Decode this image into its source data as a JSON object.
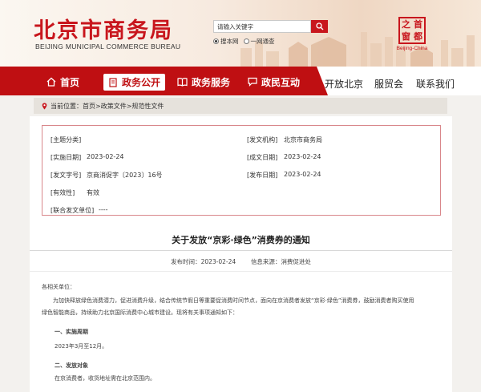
{
  "header": {
    "logo_cn": "北京市商务局",
    "logo_en": "BEIJING MUNICIPAL COMMERCE BUREAU",
    "search_placeholder": "请输入关键字",
    "radio_site": "搜本网",
    "radio_all": "一网通查",
    "capital_chars": [
      "之",
      "首",
      "窗",
      "都"
    ],
    "capital_en": "Beijing-China"
  },
  "nav": {
    "home": "首页",
    "policy": "政务公开",
    "service": "政务服务",
    "interact": "政民互动",
    "open_beijing": "开放北京",
    "trade_fair": "服贸会",
    "contact": "联系我们"
  },
  "breadcrumb": {
    "prefix": "当前位置：",
    "path": "首页>政策文件>规范性文件"
  },
  "meta": {
    "category_label": "[主题分类]",
    "category_value": "",
    "issuer_label": "[发文机构]",
    "issuer_value": "北京市商务局",
    "effective_label": "[实施日期]",
    "effective_value": "2023-02-24",
    "written_label": "[成文日期]",
    "written_value": "2023-02-24",
    "docno_label": "[发文字号]",
    "docno_value": "京商消促字〔2023〕16号",
    "publish_label": "[发布日期]",
    "publish_value": "2023-02-24",
    "validity_label": "[有效性]",
    "validity_value": "有效",
    "joint_label": "[联合发文单位]",
    "joint_value": "----"
  },
  "article": {
    "title": "关于发放“京彩·绿色”消费券的通知",
    "time_label": "发布时间：",
    "time_value": "2023-02-24",
    "source_label": "信息来源：",
    "source_value": "消费促进处",
    "salutation": "各相关单位：",
    "intro_1": "为加快释放绿色消费潜力，促进消费升级，结合传统节假日等重要促消费时间节点，面向在京消费者发放“京彩·绿色”消费券，鼓励消费者购买使用",
    "intro_2": "绿色智能商品，持续助力北京国际消费中心城市建设。现将有关事项通知如下：",
    "section1_title": "一、实施周期",
    "section1_body": "2023年3月至12月。",
    "section2_title": "二、发放对象",
    "section2_body": "在京消费者，收货地址需在北京范围内。"
  },
  "colors": {
    "brand_red": "#c8161d",
    "nav_red": "#bf0f12",
    "meta_border": "#d9878b"
  }
}
